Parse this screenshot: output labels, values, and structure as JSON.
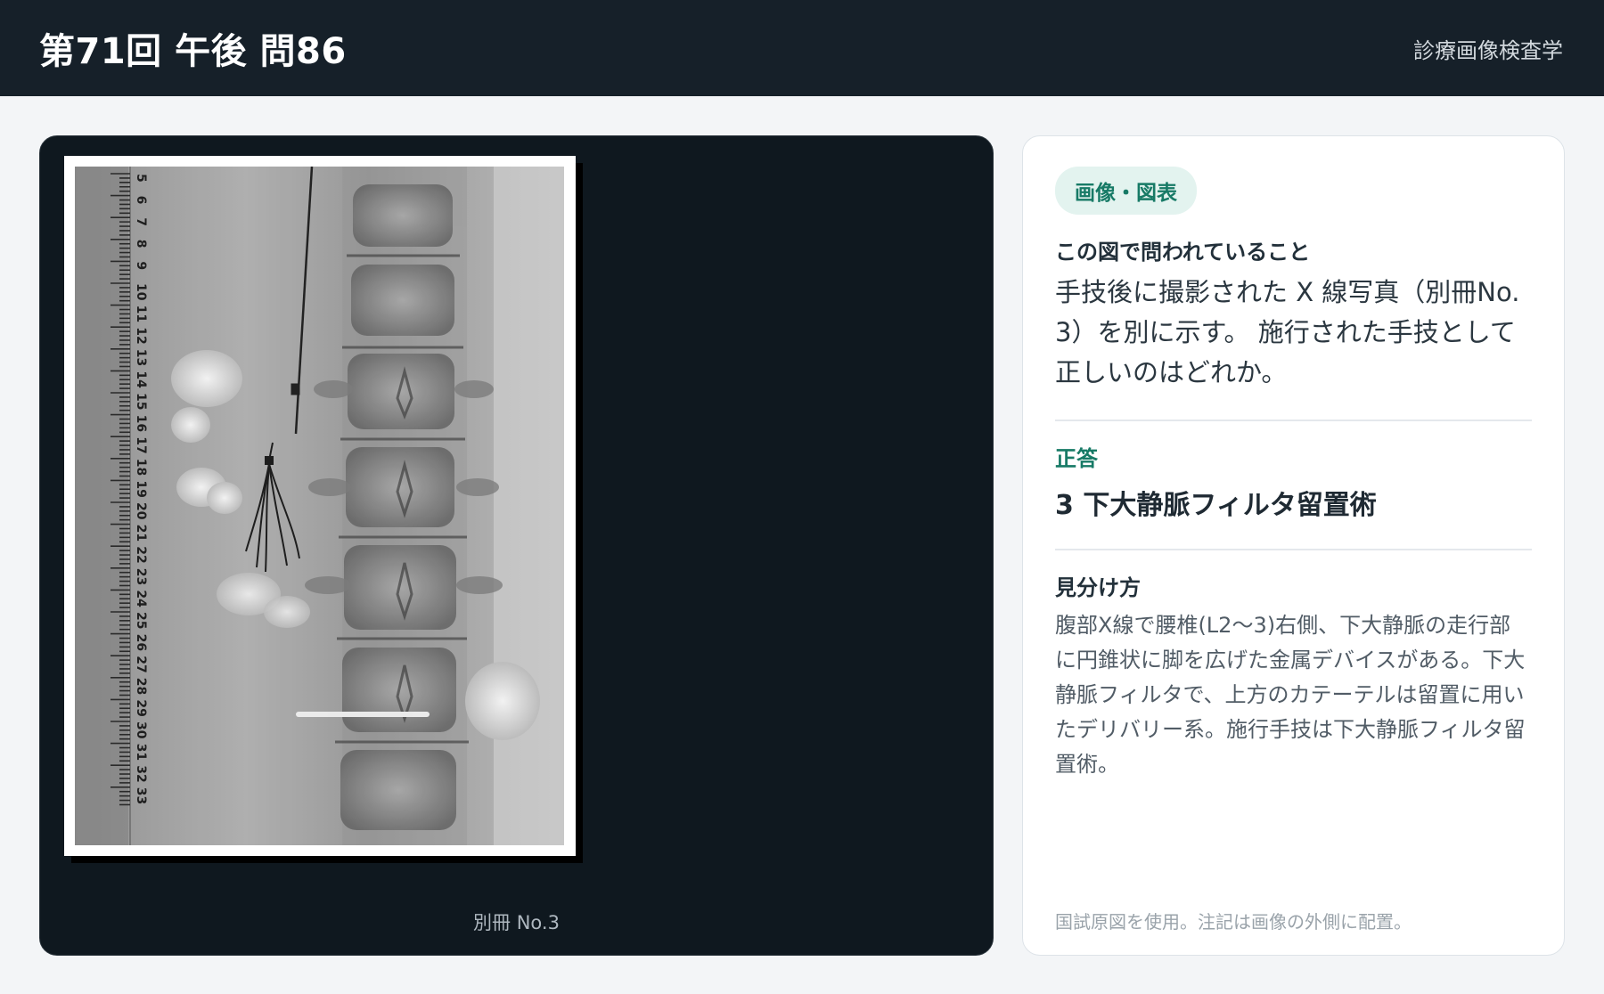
{
  "header": {
    "title": "第71回 午後 問86",
    "subject": "診療画像検査学"
  },
  "figure": {
    "caption": "別冊 No.3",
    "ruler_numbers": [
      "5",
      "6",
      "7",
      "8",
      "9",
      "10",
      "11",
      "12",
      "13",
      "14",
      "15",
      "16",
      "17",
      "18",
      "19",
      "20",
      "21",
      "22",
      "23",
      "24",
      "25",
      "26",
      "27",
      "28",
      "29",
      "30",
      "31",
      "32",
      "33"
    ]
  },
  "panel": {
    "badge": "画像・図表",
    "question_label": "この図で問われていること",
    "question_text": "手技後に撮影された X 線写真（別冊No. 3）を別に示す。 施行された手技として正しいのはどれか。",
    "answer_label": "正答",
    "answer_text": "3 下大静脈フィルタ留置術",
    "explain_label": "見分け方",
    "explain_text": "腹部X線で腰椎(L2〜3)右側、下大静脈の走行部に円錐状に脚を広げた金属デバイスがある。下大静脈フィルタで、上方のカテーテルは留置に用いたデリバリー系。施行手技は下大静脈フィルタ留置術。",
    "footnote": "国試原図を使用。注記は画像の外側に配置。"
  }
}
